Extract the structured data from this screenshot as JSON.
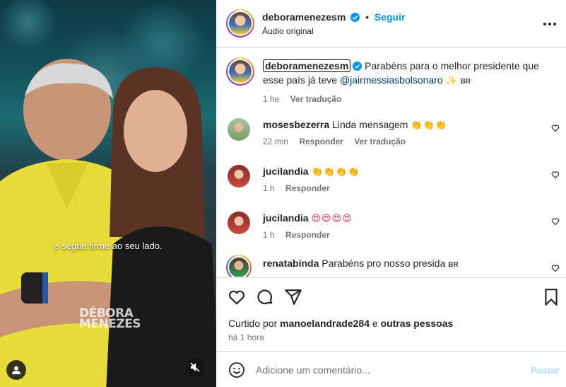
{
  "media": {
    "caption": "e segue firme ao seu lado.",
    "watermark_line1": "DÉBORA",
    "watermark_line2": "MENEZES"
  },
  "header": {
    "username": "deboramenezesm",
    "separator": "•",
    "follow_label": "Seguir",
    "audio": "Áudio original"
  },
  "post_caption": {
    "username": "deboramenezesm",
    "text": "Parabéns para o melhor presidente que esse país já teve",
    "mention": "@jairmessiasbolsonaro",
    "emoji": "✨",
    "flag": "BR",
    "time": "1 he",
    "translate": "Ver tradução"
  },
  "comments": [
    {
      "username": "mosesbezerra",
      "text": "Linda mensagem",
      "emoji": "👏👏👏",
      "time": "22 min",
      "reply": "Responder",
      "translate": "Ver tradução"
    },
    {
      "username": "jucilandia",
      "text": "",
      "emoji": "👏👏👏👏",
      "time": "1 h",
      "reply": "Responder"
    },
    {
      "username": "jucilandia",
      "text": "",
      "emoji": "😍😍😍😍",
      "time": "1 h",
      "reply": "Responder"
    },
    {
      "username": "renatabinda",
      "text": "Parabéns pro nosso presida",
      "flag": "BR"
    }
  ],
  "likes": {
    "prefix": "Curtido por",
    "user": "manoelandrade284",
    "middle": "e",
    "rest": "outras pessoas",
    "time": "há 1 hora"
  },
  "input": {
    "placeholder": "Adicione um comentário...",
    "post_label": "Postar"
  },
  "colors": {
    "accent": "#0095f6",
    "post_disabled": "#b2dffc",
    "text": "#262626",
    "secondary": "#737373"
  }
}
